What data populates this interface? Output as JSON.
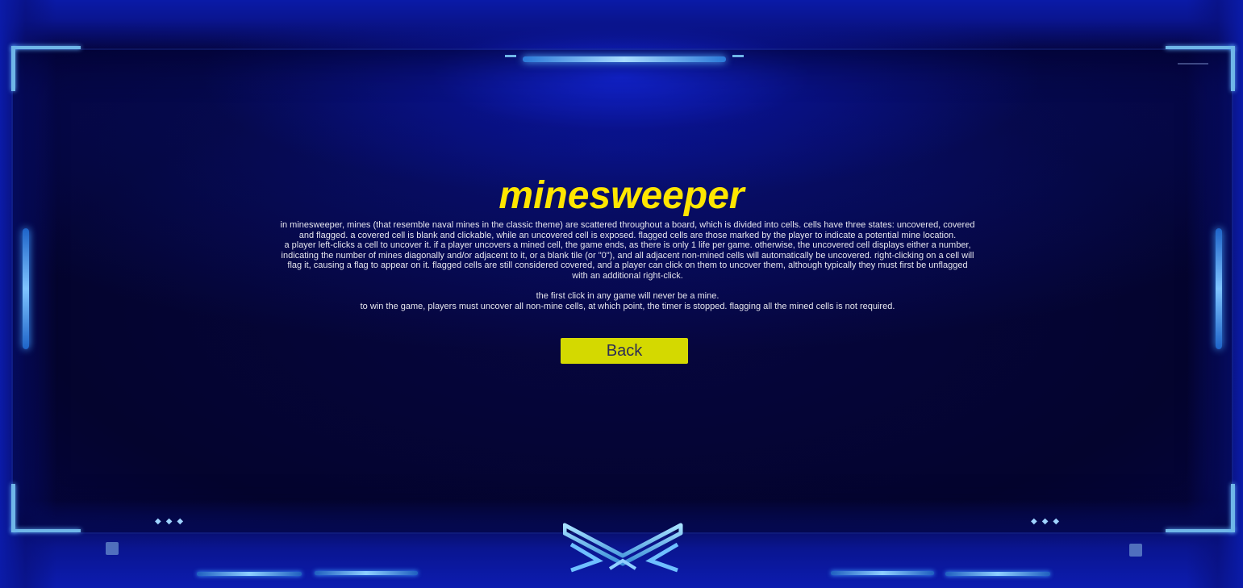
{
  "title": "minesweeper",
  "description": {
    "para1": "in minesweeper, mines (that resemble naval mines in the classic theme) are scattered throughout a board, which is divided into cells. cells have three states: uncovered, covered and flagged. a covered cell is blank and clickable, while an uncovered cell is exposed. flagged cells are those marked by the player to indicate a potential mine location.",
    "para2": "a player left-clicks a cell to uncover it. if a player uncovers a mined cell, the game ends, as there is only 1 life per game. otherwise, the uncovered cell displays either a number, indicating the number of mines diagonally and/or adjacent to it, or a blank tile (or \"0\"), and all adjacent non-mined cells will automatically be uncovered. right-clicking on a cell will flag it, causing a flag to appear on it. flagged cells are still considered covered, and a player can click on them to uncover them, although typically they must first be unflagged with an additional right-click.",
    "para3": "the first click in any game will never be a mine.",
    "para4": "to win the game, players must uncover all non-mine cells, at which point, the timer is stopped. flagging all the mined cells is not required."
  },
  "back_button": {
    "label": "Back"
  },
  "colors": {
    "title": "#ffe600",
    "button_bg": "#d4d900",
    "button_text": "#2d2d55",
    "body_text": "#e6e6ee",
    "frame_glow": "#6fb6e8",
    "background": "#03032e"
  },
  "decorations": {
    "frame_icons": [
      "corner-bracket-icon",
      "chevron-emblem-icon"
    ]
  }
}
